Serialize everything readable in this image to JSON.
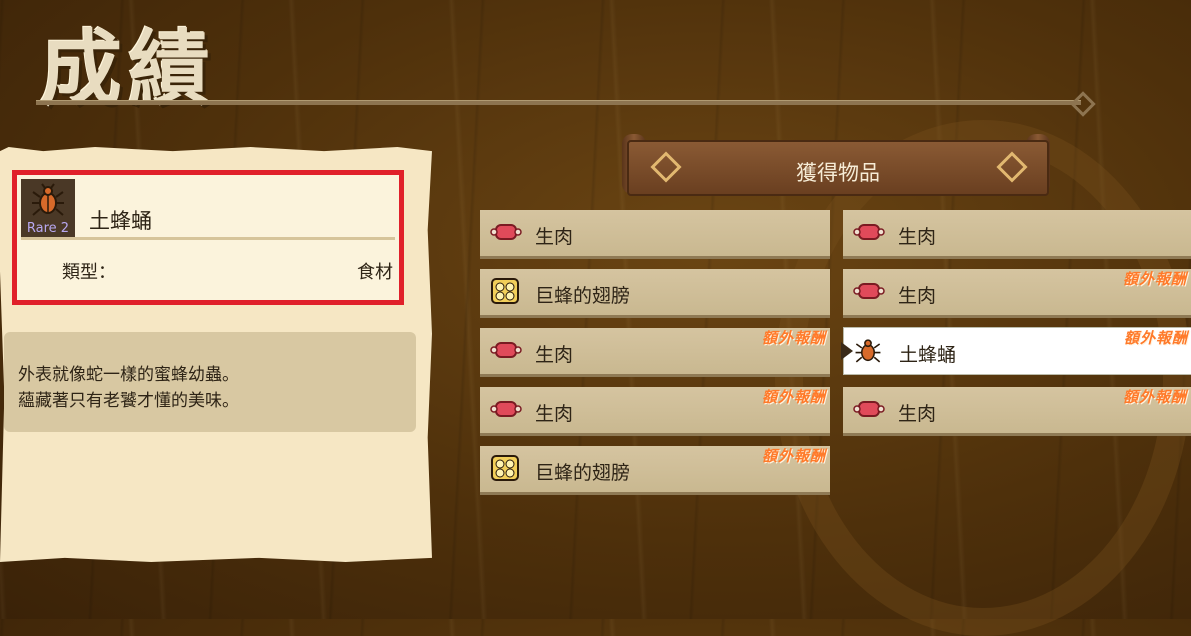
{
  "header": {
    "title": "成績"
  },
  "detail": {
    "item_name": "土蜂蛹",
    "rarity": "Rare 2",
    "item_icon": "bug-icon",
    "type_label": "類型：",
    "type_value": "食材",
    "description": [
      "外表就像蛇一樣的蜜蜂幼蟲。",
      "蘊藏著只有老饕才懂的美味。"
    ]
  },
  "rewards": {
    "title": "獲得物品",
    "bonus_text": "額外報酬",
    "items": [
      {
        "label": "生肉",
        "icon": "meat-icon",
        "bonus": false
      },
      {
        "label": "生肉",
        "icon": "meat-icon",
        "bonus": false
      },
      {
        "label": "巨蜂的翅膀",
        "icon": "wing-icon",
        "bonus": false
      },
      {
        "label": "生肉",
        "icon": "meat-icon",
        "bonus": true
      },
      {
        "label": "生肉",
        "icon": "meat-icon",
        "bonus": true
      },
      {
        "label": "土蜂蛹",
        "icon": "bug-icon",
        "bonus": true,
        "selected": true
      },
      {
        "label": "生肉",
        "icon": "meat-icon",
        "bonus": true
      },
      {
        "label": "生肉",
        "icon": "meat-icon",
        "bonus": true
      },
      {
        "label": "巨蜂的翅膀",
        "icon": "wing-icon",
        "bonus": true
      }
    ]
  },
  "colors": {
    "selection_border": "#e0202a",
    "bonus": "#ff7a2a",
    "parchment": "#f6e7c4"
  }
}
